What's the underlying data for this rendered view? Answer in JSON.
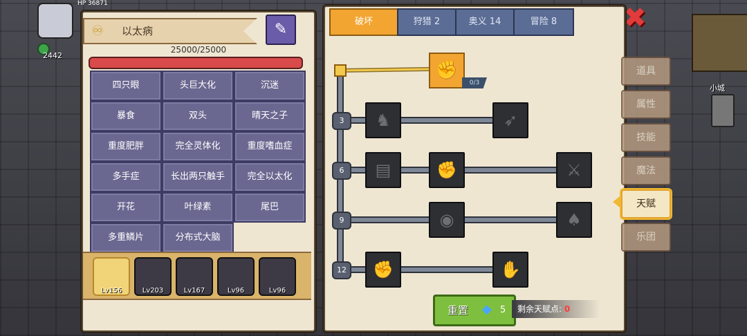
{
  "hud": {
    "coins": "2442",
    "hp_text": "HP 36871",
    "town_label": "小城"
  },
  "left_panel": {
    "name": "以太病",
    "hp": "25000/25000",
    "hp_fraction": 1.0,
    "mutations": [
      "四只眼",
      "头巨大化",
      "沉迷",
      "暴食",
      "双头",
      "晴天之子",
      "重度肥胖",
      "完全灵体化",
      "重度嗜血症",
      "多手症",
      "长出两只触手",
      "完全以太化",
      "开花",
      "叶绿素",
      "尾巴",
      "多重鳞片",
      "分布式大脑"
    ],
    "party": [
      {
        "level": "Lv156",
        "selected": true
      },
      {
        "level": "Lv203",
        "selected": false
      },
      {
        "level": "Lv167",
        "selected": false
      },
      {
        "level": "Lv96",
        "selected": false
      },
      {
        "level": "Lv96",
        "selected": false
      }
    ]
  },
  "tabs": [
    "破坏",
    "狩猎 2",
    "奥义 14",
    "冒险 8"
  ],
  "active_tab": 0,
  "talent_tree": {
    "root_count": "0/3",
    "levels": [
      "3",
      "6",
      "9",
      "12"
    ]
  },
  "reset": {
    "label": "重置",
    "cost": "5"
  },
  "remaining": {
    "label": "剩余天赋点:",
    "value": "0"
  },
  "side_tabs": [
    "道具",
    "属性",
    "技能",
    "魔法",
    "天赋",
    "乐团"
  ],
  "active_side_tab": 4,
  "colors": {
    "accent": "#f2a531",
    "tab_blue": "#5b6d94",
    "mutation": "#6a6790",
    "reset_green": "#7fbf3f",
    "remaining_red": "#ff3b3b"
  }
}
